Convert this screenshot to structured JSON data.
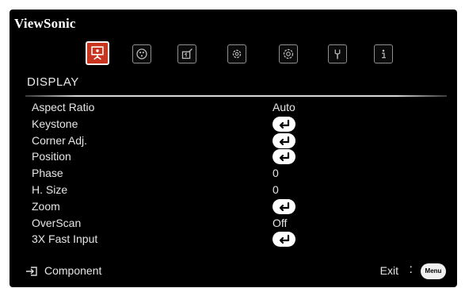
{
  "brand": "ViewSonic",
  "section_title": "DISPLAY",
  "tabs": [
    {
      "icon": "display-icon",
      "active": true
    },
    {
      "icon": "picture-icon",
      "active": false
    },
    {
      "icon": "power-management-icon",
      "active": false
    },
    {
      "icon": "basic-settings-icon",
      "active": false
    },
    {
      "icon": "advanced-settings-icon",
      "active": false
    },
    {
      "icon": "tools-icon",
      "active": false
    },
    {
      "icon": "information-icon",
      "active": false
    }
  ],
  "rows": [
    {
      "label": "Aspect Ratio",
      "value": "Auto",
      "type": "text"
    },
    {
      "label": "Keystone",
      "value": "",
      "type": "enter"
    },
    {
      "label": "Corner Adj.",
      "value": "",
      "type": "enter"
    },
    {
      "label": "Position",
      "value": "",
      "type": "enter"
    },
    {
      "label": "Phase",
      "value": "0",
      "type": "text"
    },
    {
      "label": "H. Size",
      "value": "0",
      "type": "text"
    },
    {
      "label": "Zoom",
      "value": "",
      "type": "enter"
    },
    {
      "label": "OverScan",
      "value": "Off",
      "type": "text"
    },
    {
      "label": "3X Fast Input",
      "value": "",
      "type": "enter"
    }
  ],
  "footer": {
    "source_icon": "input-source-icon",
    "source": "Component",
    "exit": "Exit",
    "separator": ":",
    "menu_button": "Menu"
  },
  "colors": {
    "background": "#000000",
    "active_tab": "#c8341e",
    "text": "#e6e6e6"
  }
}
